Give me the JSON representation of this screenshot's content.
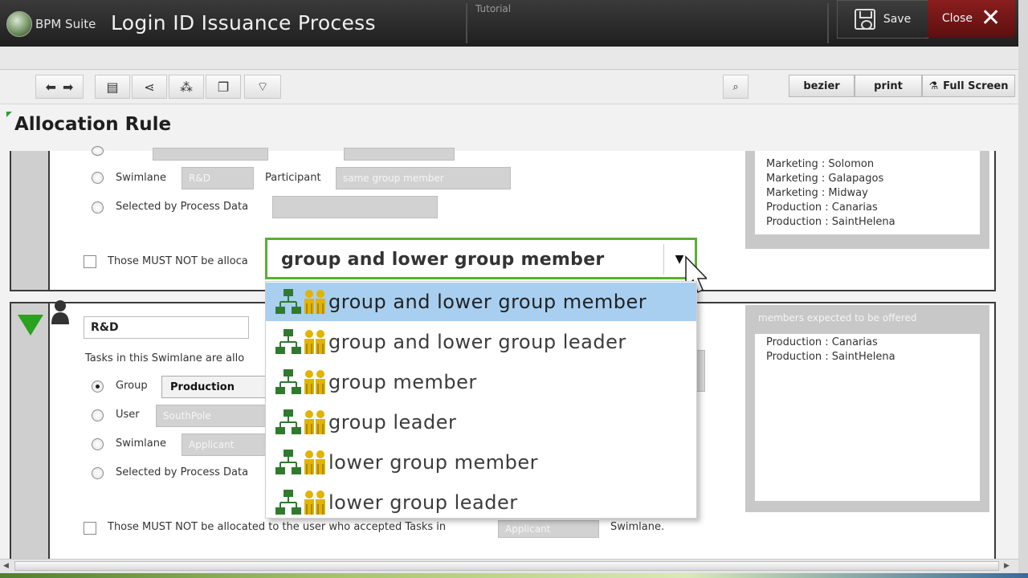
{
  "app": {
    "brand": "BPM Suite",
    "title": "Login ID Issuance Process",
    "tutorial_label": "Tutorial",
    "save_label": "Save",
    "close_label": "Close"
  },
  "toolbar": {
    "bezier_label": "bezier",
    "print_label": "print",
    "fullscreen_label": "Full Screen"
  },
  "header": {
    "title": "Allocation Rule"
  },
  "panel_top": {
    "swimlane_label": "Swimlane",
    "swimlane_value": "R&D",
    "participant_label": "Participant",
    "participant_value": "same group member",
    "process_data_label": "Selected by Process Data",
    "must_not_label": "Those MUST NOT be alloca",
    "members": [
      "Marketing : Solomon",
      "Marketing : Galapagos",
      "Marketing : Midway",
      "Production : Canarias",
      "Production : SaintHelena"
    ]
  },
  "panel_bottom": {
    "name_value": "R&D",
    "tasks_label": "Tasks in this Swimlane are allo",
    "group_label": "Group",
    "group_value": "Production",
    "user_label": "User",
    "user_value": "SouthPole",
    "swimlane_label": "Swimlane",
    "swimlane_value": "Applicant",
    "process_data_label": "Selected by Process Data",
    "must_not_label": "Those MUST NOT be allocated to the user who accepted Tasks in",
    "must_not_value": "Applicant",
    "must_not_suffix": "Swimlane.",
    "members_header": "members expected to be offered",
    "members": [
      "Production : Canarias",
      "Production : SaintHelena"
    ]
  },
  "dropdown": {
    "selected": "group and lower group member",
    "options": [
      "group and lower group member",
      "group and lower group leader",
      "group member",
      "group leader",
      "lower group member",
      "lower group leader"
    ]
  }
}
